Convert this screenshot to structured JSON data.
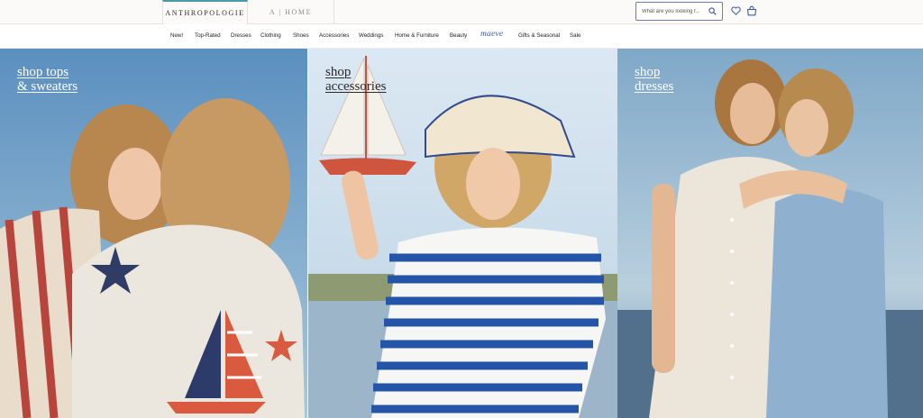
{
  "header": {
    "brand_tabs": [
      {
        "label": "ANTHROPOLOGIE",
        "active": true
      },
      {
        "label": "A | HOME",
        "active": false
      }
    ],
    "search": {
      "placeholder": "What are you looking f..."
    },
    "icons": [
      "search-icon",
      "heart-icon",
      "shopping-bag-icon"
    ],
    "accent_color": "#4a9aa8"
  },
  "nav": {
    "items": [
      {
        "label": "New!"
      },
      {
        "label": "Top-Rated"
      },
      {
        "label": "Dresses"
      },
      {
        "label": "Clothing"
      },
      {
        "label": "Shoes"
      },
      {
        "label": "Accessories"
      },
      {
        "label": "Weddings"
      },
      {
        "label": "Home & Furniture"
      },
      {
        "label": "Beauty"
      },
      {
        "label": "maeve"
      },
      {
        "label": "Gifts & Seasonal"
      },
      {
        "label": "Sale"
      }
    ]
  },
  "heroes": [
    {
      "line1": "shop tops",
      "line2": "& sweaters",
      "text_color": "#ffffff"
    },
    {
      "line1": "shop",
      "line2": "accessories",
      "text_color": "#2a2a2a"
    },
    {
      "line1": "shop",
      "line2": "dresses",
      "text_color": "#ffffff"
    }
  ]
}
